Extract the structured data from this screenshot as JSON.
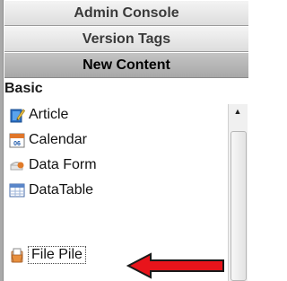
{
  "nav": {
    "admin_console": "Admin Console",
    "version_tags": "Version Tags",
    "new_content": "New Content"
  },
  "section": {
    "title": "Basic"
  },
  "items": [
    {
      "label": "Article",
      "icon": "article-icon"
    },
    {
      "label": "Calendar",
      "icon": "calendar-icon",
      "icon_text": "06"
    },
    {
      "label": "Data Form",
      "icon": "data-form-icon"
    },
    {
      "label": "DataTable",
      "icon": "datatable-icon"
    },
    {
      "label": "File Pile",
      "icon": "file-pile-icon",
      "selected": true
    }
  ],
  "colors": {
    "arrow": "#e8141b",
    "active_tab": "#b5b5b5"
  }
}
